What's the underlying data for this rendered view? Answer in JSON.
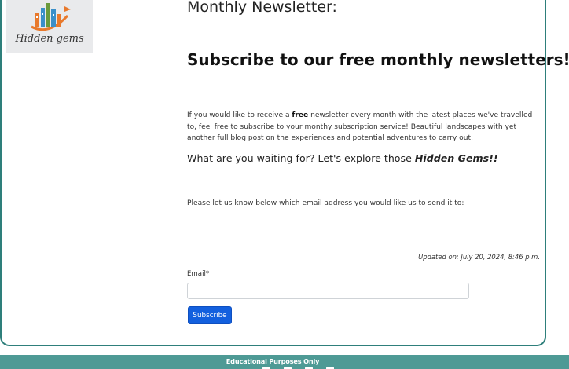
{
  "logo": {
    "text": "Hidden gems"
  },
  "newsletter": {
    "heading": "Monthly Newsletter:",
    "title": "Subscribe to our free monthly newsletters!!",
    "intro_before": "If you would like to receive a ",
    "intro_bold": "free",
    "intro_after": " newsletter every month with the latest places we've travelled to, feel free to subscribe to your monthy subscription service! Beautiful landscapes with yet another full blog post on the experiences and potential adventures to carry out.",
    "question_before": "What are you waiting for? Let's explore those ",
    "question_bold": "Hidden Gems!!",
    "ask": "Please let us know below which email address you would like us to send it to:",
    "updated": "Updated on: July 20, 2024, 8:46 p.m."
  },
  "form": {
    "email_label": "Email*",
    "email_value": "",
    "email_placeholder": "",
    "submit_label": "Subscribe"
  },
  "footer": {
    "text": "Educational Purposes Only"
  },
  "colors": {
    "accent": "#2e7f7b",
    "footer_bg": "#4e9a95",
    "button": "#1360de"
  }
}
